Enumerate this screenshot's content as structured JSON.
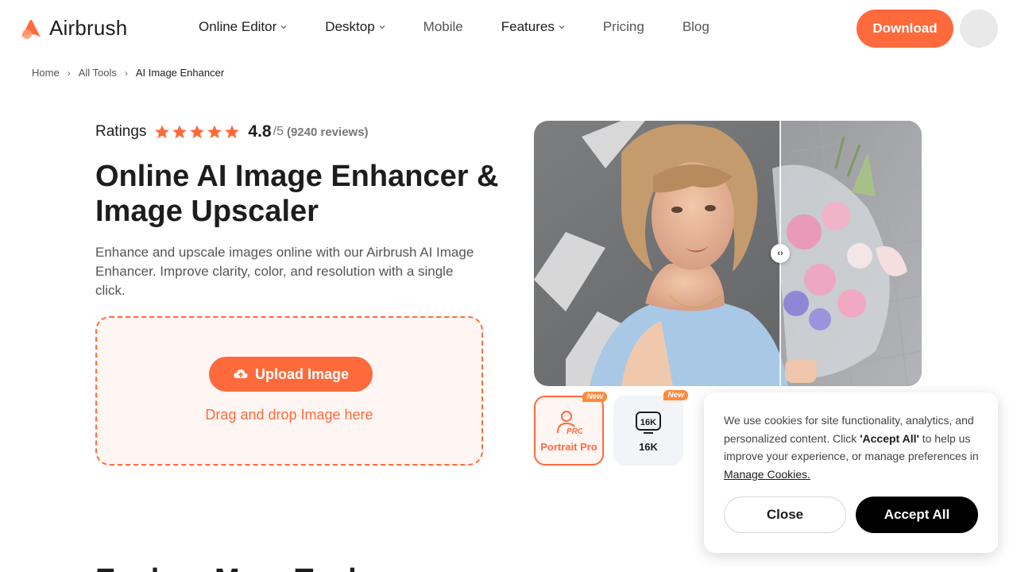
{
  "brand": {
    "name": "Airbrush",
    "accent": "#ff6a3d"
  },
  "nav": {
    "items": [
      {
        "label": "Online Editor",
        "dropdown": true
      },
      {
        "label": "Desktop",
        "dropdown": true
      },
      {
        "label": "Mobile",
        "dropdown": false
      },
      {
        "label": "Features",
        "dropdown": true
      },
      {
        "label": "Pricing",
        "dropdown": false
      },
      {
        "label": "Blog",
        "dropdown": false
      }
    ],
    "download_label": "Download"
  },
  "breadcrumb": {
    "home": "Home",
    "all_tools": "All Tools",
    "current": "AI Image Enhancer"
  },
  "ratings": {
    "label": "Ratings",
    "stars": 5,
    "score": "4.8",
    "out_of": "/5",
    "reviews": "(9240 reviews)"
  },
  "hero": {
    "title": "Online AI Image Enhancer & Image Upscaler",
    "description": "Enhance and upscale images online with our Airbrush AI Image Enhancer. Improve clarity, color, and resolution with a single click."
  },
  "upload": {
    "button_label": "Upload Image",
    "drag_text": "Drag and drop Image here"
  },
  "tiles": [
    {
      "label": "Portrait Pro",
      "badge": "New",
      "icon": "portrait-pro-icon"
    },
    {
      "label": "16K",
      "badge": "New",
      "icon": "16k-icon",
      "icon_text": "16K"
    }
  ],
  "cookie": {
    "text_before": "We use cookies for site functionality, analytics, and personalized content. Click ",
    "accept_emph": "'Accept All'",
    "text_after": " to help us improve your experience, or manage preferences in ",
    "manage_link": "Manage Cookies.",
    "close_label": "Close",
    "accept_label": "Accept All"
  },
  "next_section": {
    "heading": "Explore More Tools"
  }
}
